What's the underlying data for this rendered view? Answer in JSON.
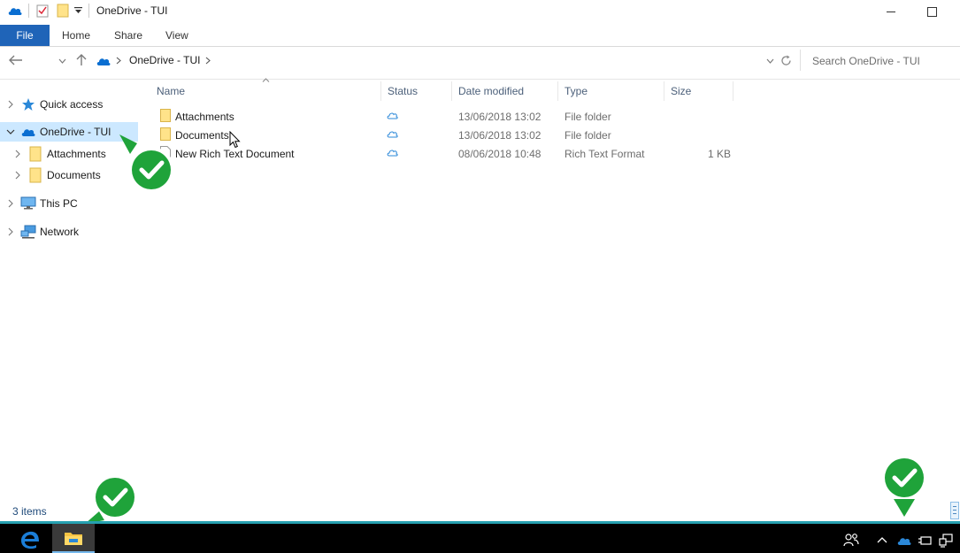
{
  "window": {
    "title": "OneDrive - TUI"
  },
  "ribbon": {
    "tabs": [
      "File",
      "Home",
      "Share",
      "View"
    ]
  },
  "address": {
    "path_label": "OneDrive - TUI",
    "search_placeholder": "Search OneDrive - TUI"
  },
  "nav": {
    "items": [
      {
        "label": "Quick access",
        "icon": "star-icon"
      },
      {
        "label": "OneDrive - TUI",
        "icon": "onedrive-cloud-icon",
        "selected": true
      },
      {
        "label": "Attachments",
        "icon": "folder-icon"
      },
      {
        "label": "Documents",
        "icon": "folder-icon"
      },
      {
        "label": "This PC",
        "icon": "monitor-icon"
      },
      {
        "label": "Network",
        "icon": "network-icon"
      }
    ]
  },
  "columns": {
    "name": "Name",
    "status": "Status",
    "date": "Date modified",
    "type": "Type",
    "size": "Size"
  },
  "files": [
    {
      "name": "Attachments",
      "status": "cloud",
      "date": "13/06/2018 13:02",
      "type": "File folder",
      "size": ""
    },
    {
      "name": "Documents",
      "status": "cloud",
      "date": "13/06/2018 13:02",
      "type": "File folder",
      "size": ""
    },
    {
      "name": "New Rich Text Document",
      "status": "cloud",
      "date": "08/06/2018 10:48",
      "type": "Rich Text Format",
      "size": "1 KB"
    }
  ],
  "status_bar": {
    "item_count": "3 items"
  },
  "colors": {
    "accent": "#1f64b8",
    "selection": "#cce8ff",
    "badge_green": "#1fa33a",
    "onedrive_blue": "#0a6ed1"
  }
}
